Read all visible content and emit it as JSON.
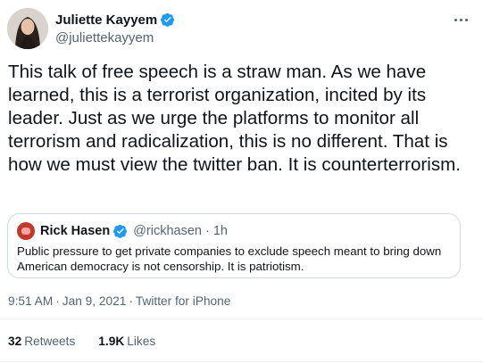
{
  "author": {
    "name": "Juliette Kayyem",
    "handle": "@juliettekayyem",
    "verified": true
  },
  "tweet": {
    "text": "This talk of free speech is a straw man. As we have learned, this is a terrorist organization, incited by its leader. Just as we urge the platforms to monitor all terrorism and radicalization, this is no different. That is how we must view the twitter ban. It is counterterrorism."
  },
  "quote": {
    "name": "Rick Hasen",
    "handle": "@rickhasen",
    "separator": "·",
    "time": "1h",
    "text": "Public pressure to get private companies to exclude speech meant to bring down American democracy is not censorship. It is patriotism."
  },
  "meta": {
    "time": "9:51 AM",
    "date": "Jan 9, 2021",
    "source": "Twitter for iPhone",
    "separator": "·"
  },
  "stats": {
    "retweets_count": "32",
    "retweets_label": "Retweets",
    "likes_count": "1.9K",
    "likes_label": "Likes"
  },
  "colors": {
    "verified_blue": "#1d9bf0",
    "text_primary": "#0f1419",
    "text_secondary": "#536471",
    "border": "#cfd9de"
  },
  "icons": {
    "more": "more-horizontal-icon",
    "verified": "verified-badge-icon"
  }
}
